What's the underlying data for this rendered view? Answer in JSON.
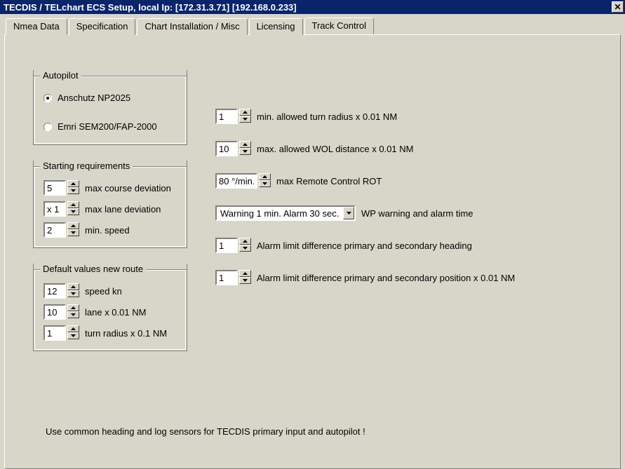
{
  "titlebar": {
    "text": "TECDIS / TELchart ECS Setup,     local Ip: [172.31.3.71] [192.168.0.233]",
    "close": "×"
  },
  "tabs": {
    "items": [
      {
        "label": "Nmea Data"
      },
      {
        "label": "Specification"
      },
      {
        "label": "Chart Installation / Misc"
      },
      {
        "label": "Licensing"
      },
      {
        "label": "Track Control"
      }
    ]
  },
  "autopilot": {
    "title": "Autopilot",
    "options": [
      {
        "label": "Anschutz NP2025"
      },
      {
        "label": "Emri SEM200/FAP-2000"
      }
    ]
  },
  "starting": {
    "title": "Starting requirements",
    "max_course_val": "5",
    "max_course_label": "max course deviation",
    "max_lane_val": "x 1",
    "max_lane_label": "max lane deviation",
    "min_speed_val": "2",
    "min_speed_label": "min. speed"
  },
  "defaults": {
    "title": "Default values new route",
    "speed_val": "12",
    "speed_label": "speed kn",
    "lane_val": "10",
    "lane_label": "lane x 0.01 NM",
    "turn_val": "1",
    "turn_label": "turn radius x 0.1 NM"
  },
  "params": {
    "min_turn_val": "1",
    "min_turn_label": "min. allowed turn radius x 0.01 NM",
    "max_wol_val": "10",
    "max_wol_label": "max. allowed WOL distance x 0.01 NM",
    "max_rot_val": "80 °/min.",
    "max_rot_label": "max Remote Control ROT",
    "wp_warn_val": "Warning 1 min.  Alarm 30 sec.",
    "wp_warn_label": "WP warning and alarm time",
    "alarm_hdg_val": "1",
    "alarm_hdg_label": "Alarm limit difference primary and secondary heading",
    "alarm_pos_val": "1",
    "alarm_pos_label": "Alarm limit difference primary and secondary position x 0.01 NM"
  },
  "footer": "Use common heading and log sensors for TECDIS primary input and autopilot !"
}
